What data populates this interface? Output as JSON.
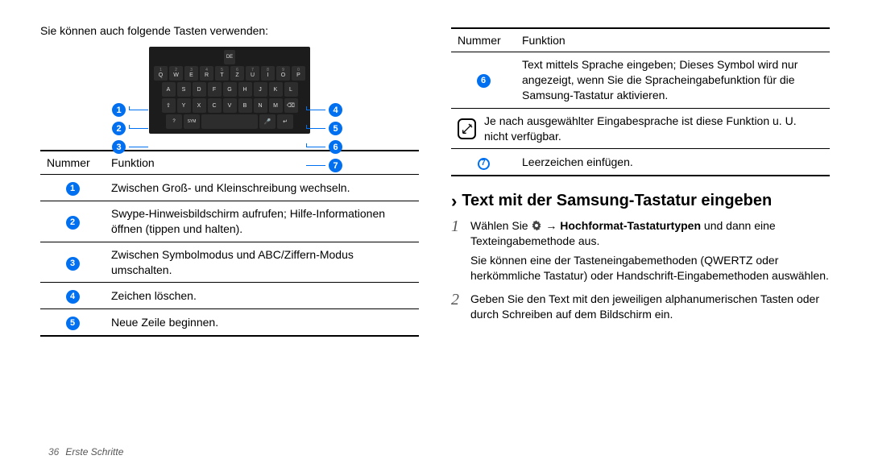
{
  "left": {
    "intro": "Sie können auch folgende Tasten verwenden:",
    "keyboard": {
      "rows": [
        [
          "Q",
          "W",
          "E",
          "R",
          "T",
          "Z",
          "U",
          "I",
          "O",
          "P"
        ],
        [
          "A",
          "S",
          "D",
          "F",
          "G",
          "H",
          "J",
          "K",
          "L"
        ],
        [
          "Y",
          "X",
          "C",
          "V",
          "B",
          "N",
          "M"
        ]
      ],
      "top_lang": "DE"
    },
    "callouts_left": [
      "1",
      "2",
      "3"
    ],
    "callouts_right": [
      "4",
      "5",
      "6",
      "7"
    ],
    "table": {
      "headers": [
        "Nummer",
        "Funktion"
      ],
      "rows": [
        {
          "n": "1",
          "text": "Zwischen Groß- und Kleinschreibung wechseln."
        },
        {
          "n": "2",
          "text": "Swype-Hinweisbildschirm aufrufen; Hilfe-Informationen öffnen (tippen und halten)."
        },
        {
          "n": "3",
          "text": "Zwischen Symbolmodus und ABC/Ziffern-Modus umschalten."
        },
        {
          "n": "4",
          "text": "Zeichen löschen."
        },
        {
          "n": "5",
          "text": "Neue Zeile beginnen."
        }
      ]
    }
  },
  "right": {
    "table": {
      "headers": [
        "Nummer",
        "Funktion"
      ],
      "rows": [
        {
          "n": "6",
          "text": "Text mittels Sprache eingeben; Dieses Symbol wird nur angezeigt, wenn Sie die Spracheingabefunktion für die Samsung-Tastatur aktivieren."
        },
        {
          "note": true,
          "text": "Je nach ausgewählter Eingabesprache ist diese Funktion u. U. nicht verfügbar."
        },
        {
          "n": "7",
          "text": "Leerzeichen einfügen."
        }
      ]
    },
    "heading": "Text mit der Samsung-Tastatur eingeben",
    "steps": [
      {
        "num": "1",
        "prefix": "Wählen Sie ",
        "bold": " → Hochformat-Tastaturtypen",
        "tail": " und dann eine Texteingabemethode aus.",
        "extra": "Sie können eine der Tasteneingabemethoden (QWERTZ oder herkömmliche Tastatur) oder Handschrift-Eingabemethoden auswählen."
      },
      {
        "num": "2",
        "text": "Geben Sie den Text mit den jeweiligen alphanumerischen Tasten oder durch Schreiben auf dem Bildschirm ein."
      }
    ]
  },
  "footer": {
    "page": "36",
    "section": "Erste Schritte"
  }
}
